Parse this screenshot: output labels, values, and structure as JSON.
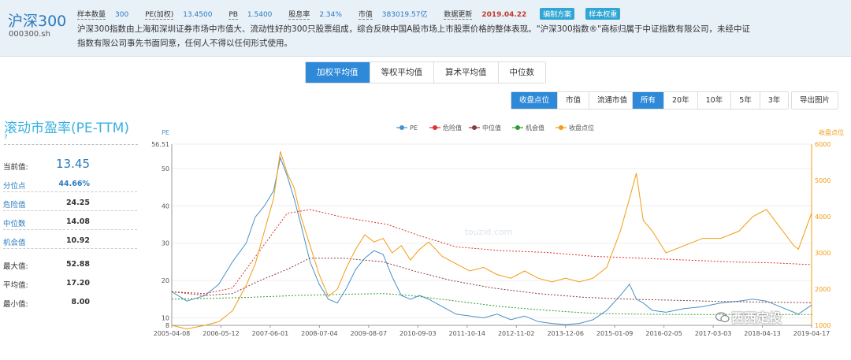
{
  "header": {
    "index_name": "沪深300",
    "index_code": "000300.sh",
    "stats": [
      {
        "label": "样本数量",
        "value": "300"
      },
      {
        "label": "PE(加权)",
        "value": "13.4500"
      },
      {
        "label": "PB",
        "value": "1.5400"
      },
      {
        "label": "股息率",
        "value": "2.34%"
      },
      {
        "label": "市值",
        "value": "383019.57亿"
      }
    ],
    "update_label": "数据更新",
    "update_date": "2019.04.22",
    "tag_method": "编制方案",
    "tag_weight": "样本权重",
    "description": "沪深300指数由上海和深圳证券市场中市值大、流动性好的300只股票组成，综合反映中国A股市场上市股票价格的整体表现。\"沪深300指数®\"商标归属于中证指数有限公司，未经中证指数有限公司事先书面同意，任何人不得以任何形式使用。"
  },
  "method_tabs": [
    "加权平均值",
    "等权平均值",
    "算术平均值",
    "中位数"
  ],
  "overlay_buttons": [
    "收盘点位",
    "市值",
    "流通市值"
  ],
  "range_buttons": [
    "所有",
    "20年",
    "10年",
    "5年",
    "3年"
  ],
  "export_label": "导出图片",
  "panel": {
    "title": "滚动市盈率(PE-TTM)",
    "help": "?",
    "current_label": "当前值:",
    "current_value": "13.45",
    "percentile_label": "分位点",
    "percentile_value": "44.66%",
    "danger_label": "危险值",
    "danger_value": "24.25",
    "median_label": "中位数",
    "median_value": "14.08",
    "chance_label": "机会值",
    "chance_value": "10.92",
    "max_label": "最大值:",
    "max_value": "52.88",
    "avg_label": "平均值:",
    "avg_value": "17.20",
    "min_label": "最小值:",
    "min_value": "8.00"
  },
  "watermark_center": "touzid.com",
  "watermark_brand": "西西定投",
  "chart_data": {
    "type": "line",
    "left_axis_label": "PE",
    "right_axis_label": "收盘点位",
    "left_ylim": [
      8,
      56.51
    ],
    "left_ticks": [
      8,
      10,
      20,
      30,
      40,
      50,
      56.51
    ],
    "right_ylim": [
      1000,
      6000
    ],
    "right_ticks": [
      1000,
      2000,
      3000,
      4000,
      5000,
      6000
    ],
    "x_ticks": [
      "2005-04-08",
      "2006-05-12",
      "2007-06-01",
      "2008-07-04",
      "2009-08-07",
      "2010-09-03",
      "2011-10-14",
      "2012-11-02",
      "2013-12-06",
      "2015-01-09",
      "2016-02-05",
      "2017-03-03",
      "2018-04-13",
      "2019-04-17"
    ],
    "x_range": [
      2005.27,
      2019.29
    ],
    "legend": [
      "PE",
      "危险值",
      "中位值",
      "机会值",
      "收盘点位"
    ],
    "colors": {
      "pe": "#4a90c8",
      "danger": "#e03030",
      "median": "#8b3a3a",
      "chance": "#2ca02c",
      "close": "#f39c12"
    },
    "series": [
      {
        "name": "PE",
        "axis": "left",
        "x": [
          2005.27,
          2005.6,
          2006.0,
          2006.3,
          2006.6,
          2006.9,
          2007.1,
          2007.3,
          2007.5,
          2007.65,
          2007.8,
          2007.95,
          2008.1,
          2008.3,
          2008.5,
          2008.7,
          2008.9,
          2009.1,
          2009.3,
          2009.5,
          2009.7,
          2009.9,
          2010.1,
          2010.3,
          2010.5,
          2010.7,
          2010.9,
          2011.2,
          2011.5,
          2011.8,
          2012.1,
          2012.4,
          2012.7,
          2013.0,
          2013.3,
          2013.6,
          2013.9,
          2014.2,
          2014.5,
          2014.8,
          2015.1,
          2015.3,
          2015.45,
          2015.6,
          2015.8,
          2016.1,
          2016.5,
          2016.9,
          2017.3,
          2017.7,
          2018.0,
          2018.3,
          2018.6,
          2018.9,
          2019.0,
          2019.29
        ],
        "y": [
          17,
          14.5,
          16,
          19,
          25,
          30,
          37,
          40,
          44,
          52.88,
          48,
          42,
          35,
          25,
          19,
          15,
          14,
          18,
          23,
          26,
          28,
          27,
          21,
          16,
          15,
          16,
          15,
          13,
          11,
          10.5,
          10,
          11,
          9.5,
          10.5,
          9,
          8.5,
          8.2,
          8.5,
          9.5,
          12,
          16,
          19,
          15,
          14,
          12,
          11.5,
          12.5,
          13,
          14,
          14.5,
          15,
          14.5,
          13,
          11.5,
          11,
          13.45
        ]
      },
      {
        "name": "危险值",
        "axis": "left",
        "x": [
          2005.27,
          2006.0,
          2006.6,
          2007.2,
          2007.8,
          2008.3,
          2009.0,
          2010.0,
          2010.7,
          2011.5,
          2012.5,
          2013.5,
          2014.5,
          2015.5,
          2016.5,
          2017.5,
          2018.5,
          2019.29
        ],
        "y": [
          17,
          16.5,
          18,
          28,
          38,
          39,
          37,
          35,
          32,
          29,
          28,
          27.5,
          26.5,
          26,
          25.5,
          25,
          24.7,
          24.25
        ]
      },
      {
        "name": "中位值",
        "axis": "left",
        "x": [
          2005.27,
          2006.0,
          2006.6,
          2007.2,
          2007.8,
          2008.3,
          2009.0,
          2009.9,
          2010.6,
          2011.4,
          2012.3,
          2013.3,
          2014.3,
          2015.3,
          2016.3,
          2017.3,
          2018.3,
          2019.29
        ],
        "y": [
          17,
          16,
          16.5,
          20,
          23,
          26,
          26,
          25,
          22.5,
          20,
          18,
          16.5,
          15.5,
          15,
          14.7,
          14.4,
          14.2,
          14.08
        ]
      },
      {
        "name": "机会值",
        "axis": "left",
        "x": [
          2005.27,
          2006.0,
          2007.0,
          2008.0,
          2009.0,
          2009.9,
          2010.5,
          2011.5,
          2012.5,
          2013.5,
          2014.5,
          2015.5,
          2016.5,
          2017.5,
          2018.5,
          2019.29
        ],
        "y": [
          15,
          15.2,
          15.5,
          16,
          16.3,
          16.5,
          16,
          14.5,
          13,
          12,
          11.2,
          11,
          10.9,
          10.9,
          10.9,
          10.92
        ]
      },
      {
        "name": "收盘点位",
        "axis": "right",
        "x": [
          2005.27,
          2005.6,
          2006.0,
          2006.3,
          2006.6,
          2006.9,
          2007.1,
          2007.3,
          2007.5,
          2007.65,
          2007.8,
          2007.95,
          2008.1,
          2008.3,
          2008.5,
          2008.7,
          2008.9,
          2009.1,
          2009.3,
          2009.5,
          2009.7,
          2009.9,
          2010.1,
          2010.3,
          2010.5,
          2010.7,
          2010.9,
          2011.2,
          2011.5,
          2011.8,
          2012.1,
          2012.4,
          2012.7,
          2013.0,
          2013.3,
          2013.6,
          2013.9,
          2014.2,
          2014.5,
          2014.8,
          2015.1,
          2015.3,
          2015.45,
          2015.6,
          2015.8,
          2016.1,
          2016.5,
          2016.9,
          2017.3,
          2017.7,
          2018.0,
          2018.3,
          2018.6,
          2018.9,
          2019.0,
          2019.29
        ],
        "y": [
          1000,
          900,
          1000,
          1100,
          1400,
          2100,
          2700,
          3600,
          4500,
          5800,
          5200,
          4800,
          4000,
          3200,
          2400,
          1800,
          2000,
          2600,
          3100,
          3500,
          3300,
          3400,
          3000,
          3200,
          2800,
          3100,
          3300,
          2900,
          2700,
          2500,
          2600,
          2400,
          2300,
          2500,
          2300,
          2200,
          2300,
          2200,
          2300,
          2600,
          3600,
          4500,
          5200,
          3900,
          3600,
          3000,
          3200,
          3400,
          3400,
          3600,
          4000,
          4200,
          3700,
          3200,
          3100,
          4100
        ]
      }
    ]
  }
}
